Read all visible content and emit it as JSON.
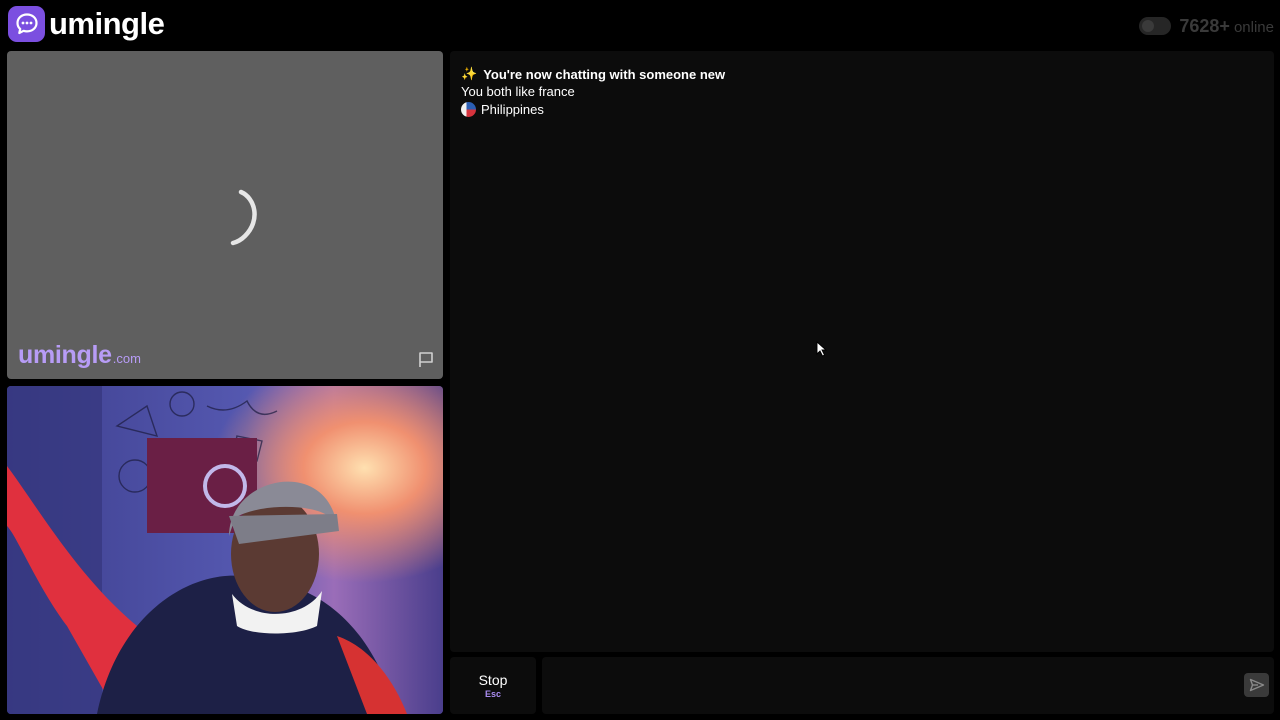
{
  "app": {
    "brand": "umingle"
  },
  "header": {
    "online_count": "7628+",
    "online_label": "online"
  },
  "stranger_video": {
    "watermark_main": "umingle",
    "watermark_suffix": ".com",
    "status": "loading"
  },
  "chat": {
    "messages": [
      {
        "icon": "sparkles-icon",
        "text": "You're now chatting with someone new"
      },
      {
        "text": "You both like france"
      },
      {
        "icon": "philippines-flag-icon",
        "text": "Philippines"
      }
    ]
  },
  "controls": {
    "stop_label": "Stop",
    "stop_shortcut": "Esc",
    "message_placeholder": "",
    "send_icon": "send-icon"
  },
  "colors": {
    "accent": "#7b4fe0",
    "accent_light": "#b79cf6",
    "background": "#000000",
    "panel": "#0c0c0c",
    "video_placeholder": "#5f5f5f"
  }
}
